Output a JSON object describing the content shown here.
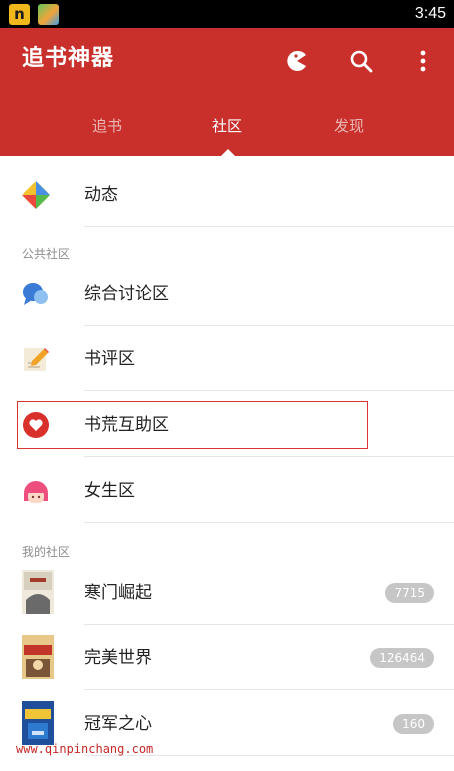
{
  "status_bar": {
    "app1_letter": "n",
    "time": "3:45"
  },
  "app_bar": {
    "title": "追书神器",
    "icons": [
      "pacman-icon",
      "search-icon",
      "more-vertical-icon"
    ],
    "tabs": [
      {
        "label": "追书",
        "active": false
      },
      {
        "label": "社区",
        "active": true
      },
      {
        "label": "发现",
        "active": false
      }
    ],
    "accent_color": "#c9302c"
  },
  "list": {
    "feed_item": {
      "label": "动态",
      "icon": "feed-icon"
    },
    "public_section_title": "公共社区",
    "public_items": [
      {
        "label": "综合讨论区",
        "icon": "chat-bubbles-icon"
      },
      {
        "label": "书评区",
        "icon": "pencil-note-icon"
      },
      {
        "label": "书荒互助区",
        "icon": "heart-icon"
      },
      {
        "label": "女生区",
        "icon": "girl-face-icon"
      }
    ],
    "my_section_title": "我的社区",
    "my_items": [
      {
        "label": "寒门崛起",
        "count": "7715"
      },
      {
        "label": "完美世界",
        "count": "126464"
      },
      {
        "label": "冠军之心",
        "count": "160"
      }
    ]
  },
  "watermark": "www.qinpinchang.com"
}
